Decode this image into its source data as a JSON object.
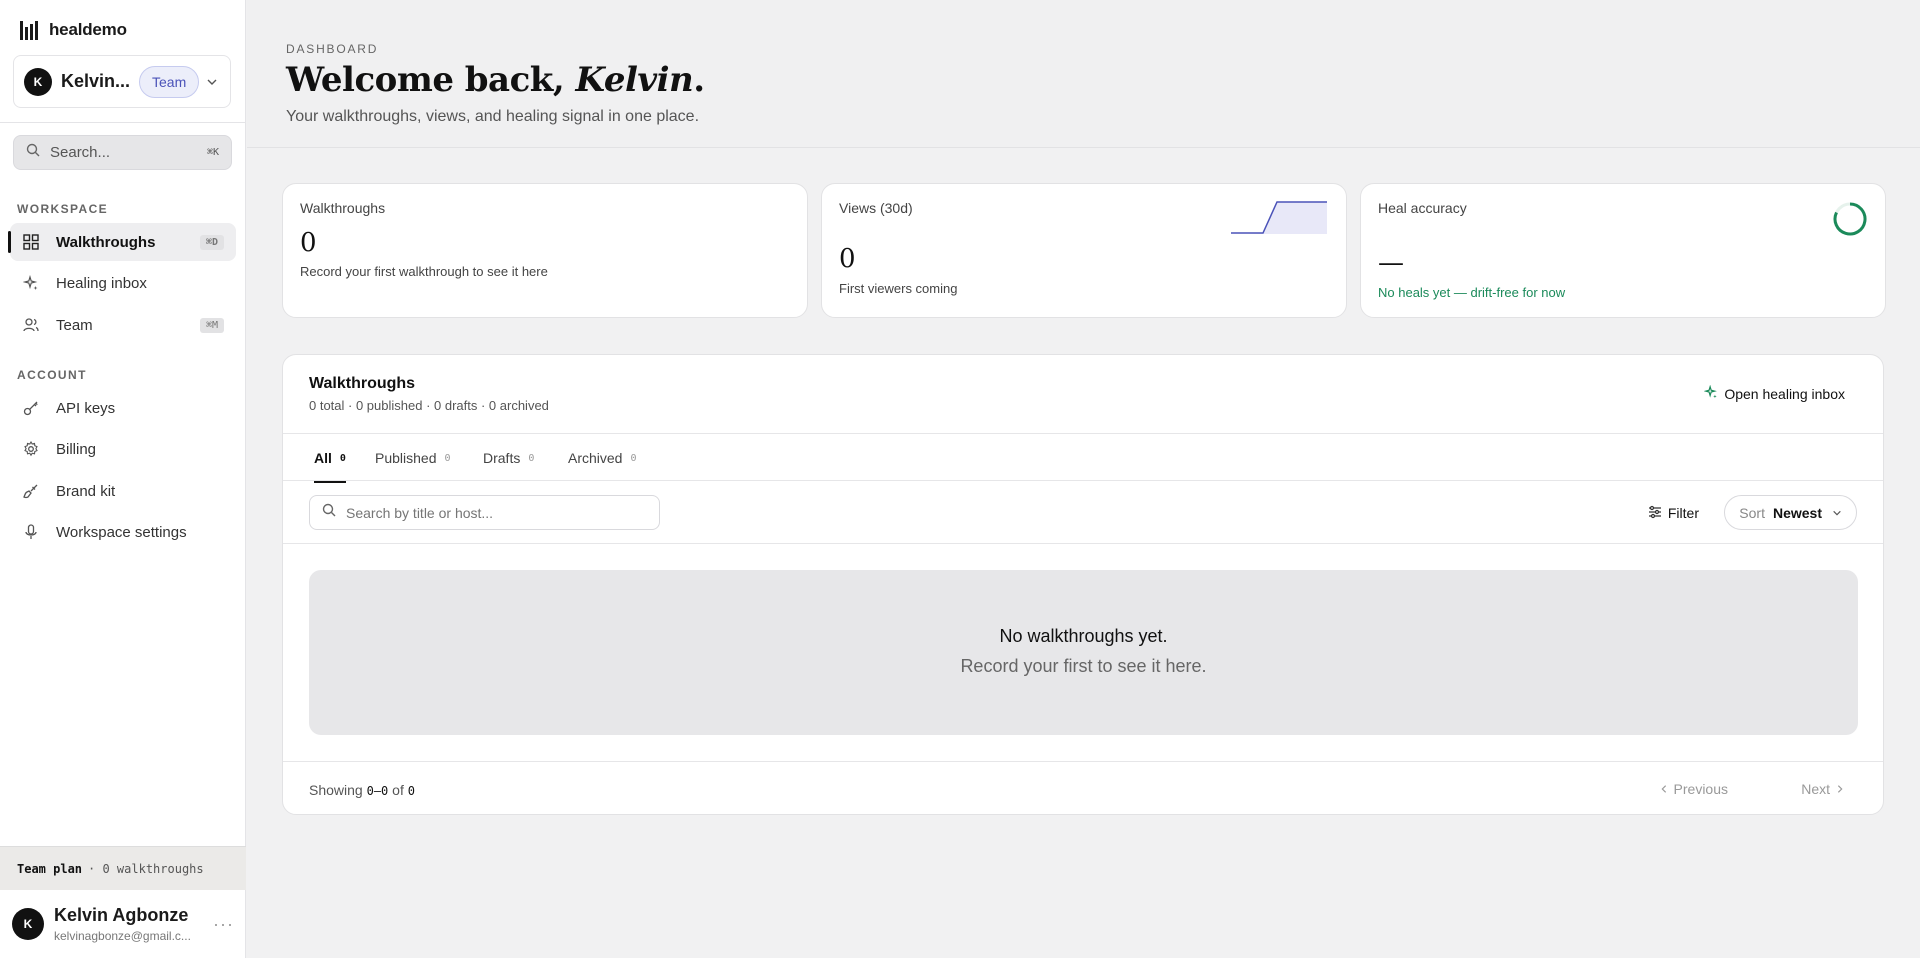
{
  "brand": {
    "name": "healdemo"
  },
  "workspace": {
    "avatar_initial": "K",
    "name": "Kelvin...",
    "plan_badge": "Team"
  },
  "search": {
    "placeholder": "Search...",
    "shortcut": "⌘K"
  },
  "sidebar": {
    "workspace_label": "WORKSPACE",
    "workspace_items": [
      {
        "label": "Walkthroughs",
        "icon": "grid-icon",
        "shortcut": "⌘D",
        "active": true
      },
      {
        "label": "Healing inbox",
        "icon": "sparkle-icon",
        "shortcut": "",
        "active": false
      },
      {
        "label": "Team",
        "icon": "users-icon",
        "shortcut": "⌘M",
        "active": false
      }
    ],
    "account_label": "ACCOUNT",
    "account_items": [
      {
        "label": "API keys",
        "icon": "key-icon"
      },
      {
        "label": "Billing",
        "icon": "gear-icon"
      },
      {
        "label": "Brand kit",
        "icon": "brush-icon"
      },
      {
        "label": "Workspace settings",
        "icon": "mic-icon"
      }
    ]
  },
  "plan_bar": {
    "plan": "Team plan",
    "detail": "· 0 walkthroughs"
  },
  "user": {
    "avatar_initial": "K",
    "name": "Kelvin Agbonze",
    "email": "kelvinagbonze@gmail.c...",
    "more": "···"
  },
  "header": {
    "eyebrow": "DASHBOARD",
    "welcome_prefix": "Welcome back, ",
    "welcome_name": "Kelvin",
    "welcome_suffix": ".",
    "subtitle": "Your walkthroughs, views, and healing signal in one place."
  },
  "cards": [
    {
      "label": "Walkthroughs",
      "value": "0",
      "note": "Record your first walkthrough to see it here"
    },
    {
      "label": "Views (30d)",
      "value": "0",
      "note": "First viewers coming"
    },
    {
      "label": "Heal accuracy",
      "value": "—",
      "note": "No heals yet — drift-free for now"
    }
  ],
  "panel": {
    "title": "Walkthroughs",
    "stats": "0 total · 0 published · 0 drafts · 0 archived",
    "open_inbox": "Open healing inbox",
    "tabs": [
      {
        "label": "All",
        "count": "0",
        "active": true
      },
      {
        "label": "Published",
        "count": "0",
        "active": false
      },
      {
        "label": "Drafts",
        "count": "0",
        "active": false
      },
      {
        "label": "Archived",
        "count": "0",
        "active": false
      }
    ],
    "search_placeholder": "Search by title or host...",
    "filter_label": "Filter",
    "sort_label": "Sort",
    "sort_value": "Newest",
    "empty_title": "No walkthroughs yet.",
    "empty_sub": "Record your first to see it here.",
    "showing_prefix": "Showing",
    "showing_range": "0–0",
    "showing_of": "of",
    "showing_total": "0",
    "previous": "Previous",
    "next": "Next"
  },
  "colors": {
    "accent": "#4a52b8",
    "success": "#1b8a5a",
    "dark": "#111111"
  }
}
